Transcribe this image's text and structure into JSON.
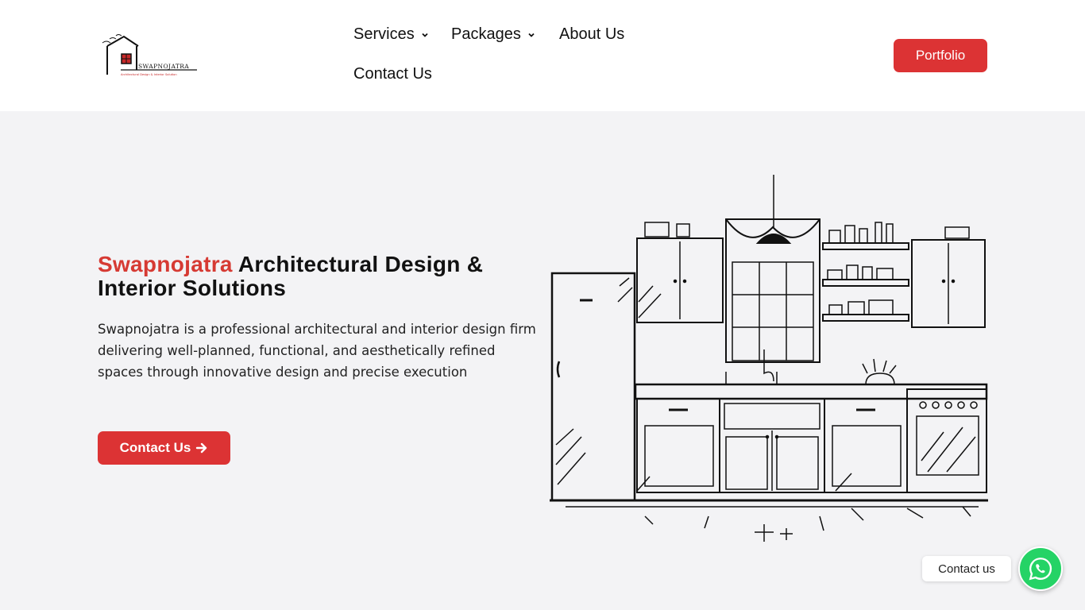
{
  "logo": {
    "text": "SWAPNOJATRA",
    "tagline": "Architectural Design & Interior Solution"
  },
  "nav": {
    "services": "Services",
    "packages": "Packages",
    "about": "About Us",
    "contact": "Contact Us"
  },
  "header": {
    "portfolio_label": "Portfolio"
  },
  "hero": {
    "title_brand": "Swapnojatra",
    "title_rest": " Architectural Design & Interior Solutions",
    "description": "Swapnojatra is a professional architectural and interior design firm delivering well-planned, functional, and aesthetically refined spaces through innovative design and precise execution",
    "cta_label": "Contact Us"
  },
  "chat": {
    "label": "Contact us"
  },
  "colors": {
    "accent": "#dc3334",
    "brand_text": "#d63a33",
    "whatsapp": "#25d366",
    "background": "#f3f3f5"
  }
}
